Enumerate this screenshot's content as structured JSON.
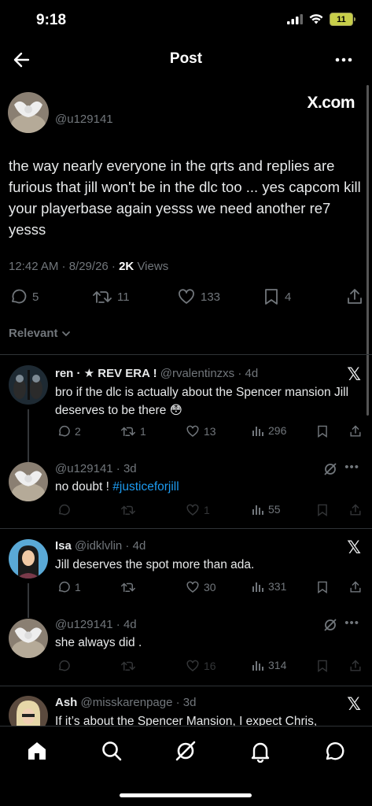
{
  "status_bar": {
    "time": "9:18",
    "battery": "11"
  },
  "nav": {
    "title": "Post"
  },
  "main_post": {
    "handle": "@u129141",
    "brand": "X.com",
    "text": "the way nearly everyone in the qrts and replies are furious that jill won't be in the dlc too ... yes capcom kill your playerbase again yesss we need another re7 yesss",
    "time": "12:42 AM · 8/29/26 · ",
    "views_count": "2K",
    "views_label": " Views",
    "replies": "5",
    "reposts": "11",
    "likes": "133",
    "bookmarks": "4"
  },
  "sort_label": "Relevant",
  "replies": [
    {
      "name": "ren · ★ REV ERA !",
      "handle": " @rvalentinzxs · 4d",
      "text": "bro if the dlc is actually about the Spencer mansion Jill deserves to be there 😳",
      "replies": "2",
      "reposts": "1",
      "likes": "13",
      "views": "296"
    },
    {
      "name": "",
      "handle": "@u129141 · 3d",
      "text_plain": "no doubt ! ",
      "hashtag": "#justiceforjill",
      "replies": "",
      "reposts": "",
      "likes": "1",
      "views": "55"
    },
    {
      "name": "Isa",
      "handle": " @idklvlin · 4d",
      "text": "Jill deserves the spot more than ada.",
      "replies": "1",
      "reposts": "",
      "likes": "30",
      "views": "331"
    },
    {
      "name": "",
      "handle": "@u129141 · 4d",
      "text": "she always did .",
      "replies": "",
      "reposts": "",
      "likes": "16",
      "views": "314"
    },
    {
      "name": "Ash",
      "handle": " @misskarenpage · 3d",
      "text": "If it’s about the Spencer Mansion, I expect Chris,"
    }
  ],
  "tabs": [
    "home-icon",
    "search-icon",
    "grok-icon",
    "notifications-icon",
    "messages-icon"
  ]
}
